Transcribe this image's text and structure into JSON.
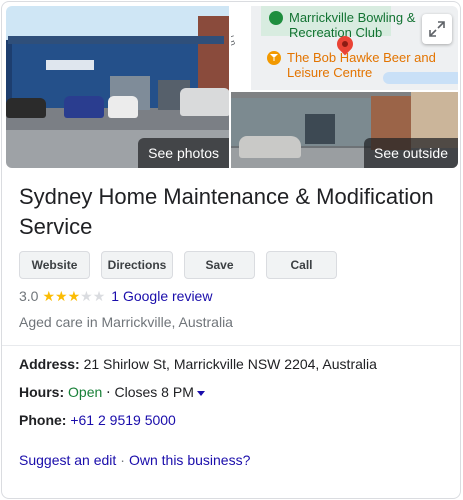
{
  "photos": {
    "main_label": "See photos",
    "outside_label": "See outside"
  },
  "map": {
    "poi_green": "Marrickville Bowling & Recreation Club",
    "poi_orange": "The Bob Hawke Beer and Leisure Centre",
    "street": "Ln"
  },
  "business": {
    "name": "Sydney Home Maintenance & Modification Service",
    "category": "Aged care in Marrickville, Australia"
  },
  "actions": {
    "website": "Website",
    "directions": "Directions",
    "save": "Save",
    "call": "Call"
  },
  "rating": {
    "value": "3.0",
    "stars_filled": 3,
    "stars_total": 5,
    "reviews_link": "1 Google review"
  },
  "details": {
    "address_label": "Address:",
    "address": "21 Shirlow St, Marrickville NSW 2204, Australia",
    "hours_label": "Hours:",
    "hours_status": "Open",
    "hours_sep": "⋅",
    "hours_close": "Closes 8 PM",
    "phone_label": "Phone:",
    "phone": "+61 2 9519 5000"
  },
  "footer": {
    "suggest_edit": "Suggest an edit",
    "separator": "·",
    "own_business": "Own this business?"
  },
  "colors": {
    "link": "#1a0dab",
    "open": "#188038",
    "star": "#fbbc04",
    "poi_green": "#137333",
    "poi_orange": "#e37400",
    "pin_red": "#ea4335"
  }
}
